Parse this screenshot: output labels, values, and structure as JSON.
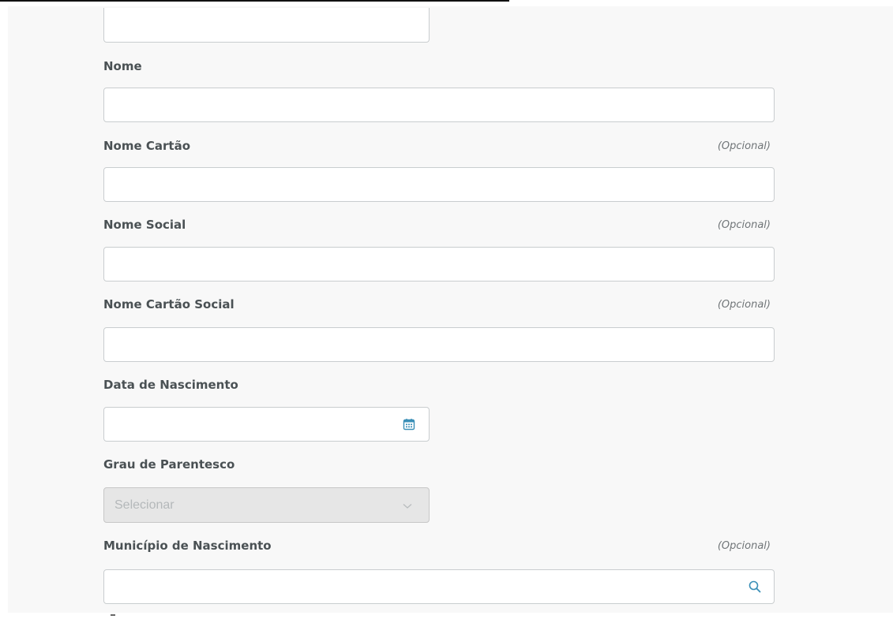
{
  "form": {
    "fields": {
      "previous": {
        "value": ""
      },
      "nome": {
        "label": "Nome",
        "value": ""
      },
      "nome_cartao": {
        "label": "Nome Cartão",
        "optional": "(Opcional)",
        "value": ""
      },
      "nome_social": {
        "label": "Nome Social",
        "optional": "(Opcional)",
        "value": ""
      },
      "nome_cartao_social": {
        "label": "Nome Cartão Social",
        "optional": "(Opcional)",
        "value": ""
      },
      "data_nascimento": {
        "label": "Data de Nascimento",
        "value": "",
        "icon": "calendar-icon"
      },
      "grau_parentesco": {
        "label": "Grau de Parentesco",
        "placeholder": "Selecionar",
        "icon": "chevron-down-icon",
        "disabled": true
      },
      "municipio_nascimento": {
        "label": "Município de Nascimento",
        "optional": "(Opcional)",
        "value": "",
        "icon": "search-icon"
      }
    }
  },
  "colors": {
    "accent": "#3a8fb7",
    "label": "#4a5154",
    "optional": "#707578",
    "border": "#c9cdcf",
    "panel_background": "#f8f8f8",
    "disabled_background": "#e6e6e6"
  }
}
